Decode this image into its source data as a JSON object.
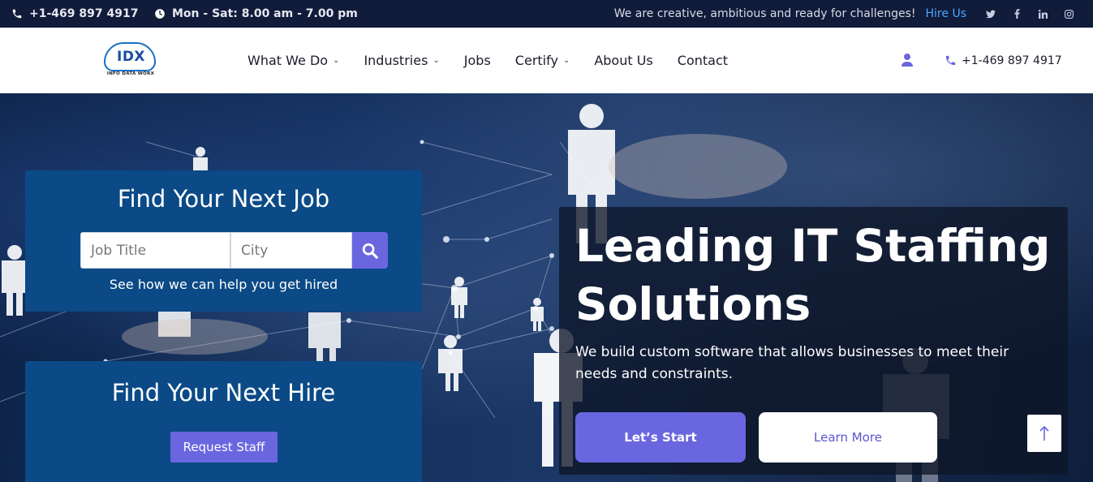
{
  "topbar": {
    "phone": "+1-469 897 4917",
    "hours": "Mon - Sat: 8.00 am - 7.00 pm",
    "tagline": "We are creative, ambitious and ready for challenges!",
    "hire_link": "Hire Us",
    "socials": [
      "twitter-icon",
      "facebook-icon",
      "linkedin-icon",
      "instagram-icon"
    ]
  },
  "header": {
    "logo_text": "IDX",
    "logo_sub": "INFO DATA WORX",
    "nav": [
      {
        "label": "What We Do",
        "dropdown": true
      },
      {
        "label": "Industries",
        "dropdown": true
      },
      {
        "label": "Jobs",
        "dropdown": false
      },
      {
        "label": "Certify",
        "dropdown": true
      },
      {
        "label": "About Us",
        "dropdown": false
      },
      {
        "label": "Contact",
        "dropdown": false
      }
    ],
    "phone": "+1-469 897 4917"
  },
  "job_card": {
    "title": "Find Your Next Job",
    "job_placeholder": "Job Title",
    "city_placeholder": "City",
    "help_text": "See how we can help you get hired"
  },
  "hire_card": {
    "title": "Find Your Next Hire",
    "button": "Request Staff"
  },
  "hero": {
    "title": "Leading IT Staffing Solutions",
    "subtitle": "We build custom software that allows businesses to meet their needs and constraints.",
    "primary_button": "Let’s Start",
    "secondary_button": "Learn More"
  },
  "colors": {
    "topbar_bg": "#111b3a",
    "accent": "#6a66e0",
    "card_bg": "#0b4a86",
    "link": "#4aa8ff"
  }
}
